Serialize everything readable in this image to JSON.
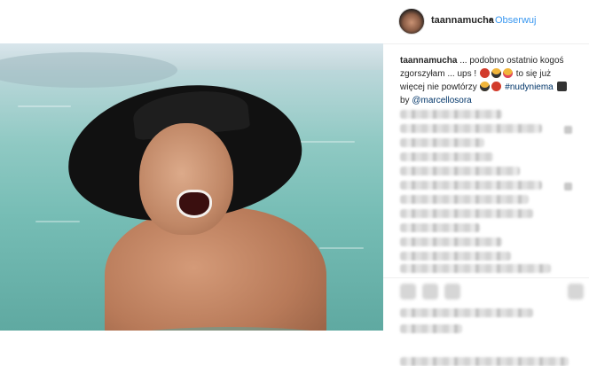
{
  "header": {
    "username": "taannamucha",
    "separator": "•",
    "follow_label": "Obserwuj"
  },
  "caption": {
    "username": "taannamucha",
    "text_1": " ... podobno ostatnio kogoś zgorszyłam ... ups ! ",
    "text_2": " to się już więcej nie powtórzy ",
    "hashtag": "#nudyniema",
    "by_label": "by ",
    "mention": "@marcellosora"
  },
  "icons": [
    "devil-emoji",
    "sunglasses-emoji",
    "tongue-emoji",
    "camera-emoji",
    "heart-icon",
    "comment-icon",
    "share-icon",
    "bookmark-icon"
  ],
  "colors": {
    "link": "#3897f0",
    "text": "#262626",
    "tag": "#003569"
  }
}
